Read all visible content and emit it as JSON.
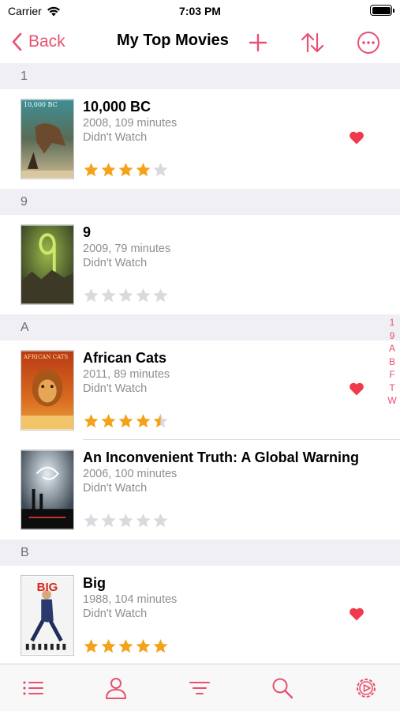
{
  "status_bar": {
    "carrier": "Carrier",
    "time": "7:03 PM"
  },
  "nav": {
    "back_label": "Back",
    "title": "My Top Movies"
  },
  "colors": {
    "accent": "#e8506f",
    "star_on": "#f5a21b",
    "star_off": "#d9d9de",
    "heart": "#f0394a",
    "section_bg": "#efeff4"
  },
  "sections": [
    {
      "header": "1",
      "movies": [
        {
          "title": "10,000 BC",
          "year_runtime": "2008, 109 minutes",
          "status": "Didn't Watch",
          "favorite": true,
          "rating": 4
        }
      ]
    },
    {
      "header": "9",
      "movies": [
        {
          "title": "9",
          "year_runtime": "2009, 79 minutes",
          "status": "Didn't Watch",
          "favorite": false,
          "rating": 0
        }
      ]
    },
    {
      "header": "A",
      "movies": [
        {
          "title": "African Cats",
          "year_runtime": "2011, 89 minutes",
          "status": "Didn't Watch",
          "favorite": true,
          "rating": 4.5
        },
        {
          "title": "An Inconvenient Truth: A Global Warning",
          "year_runtime": "2006, 100 minutes",
          "status": "Didn't Watch",
          "favorite": false,
          "rating": 0
        }
      ]
    },
    {
      "header": "B",
      "movies": [
        {
          "title": "Big",
          "year_runtime": "1988, 104 minutes",
          "status": "Didn't Watch",
          "favorite": true,
          "rating": 5
        }
      ]
    }
  ],
  "posters": {
    "p1": "10,000 BC",
    "p3": "AFRICAN CATS",
    "p5": "BIG"
  },
  "index": [
    "1",
    "9",
    "A",
    "B",
    "F",
    "T",
    "W"
  ],
  "tab_bar": {
    "tabs": [
      "list-icon",
      "person-icon",
      "filter-icon",
      "search-icon",
      "settings-icon"
    ]
  }
}
